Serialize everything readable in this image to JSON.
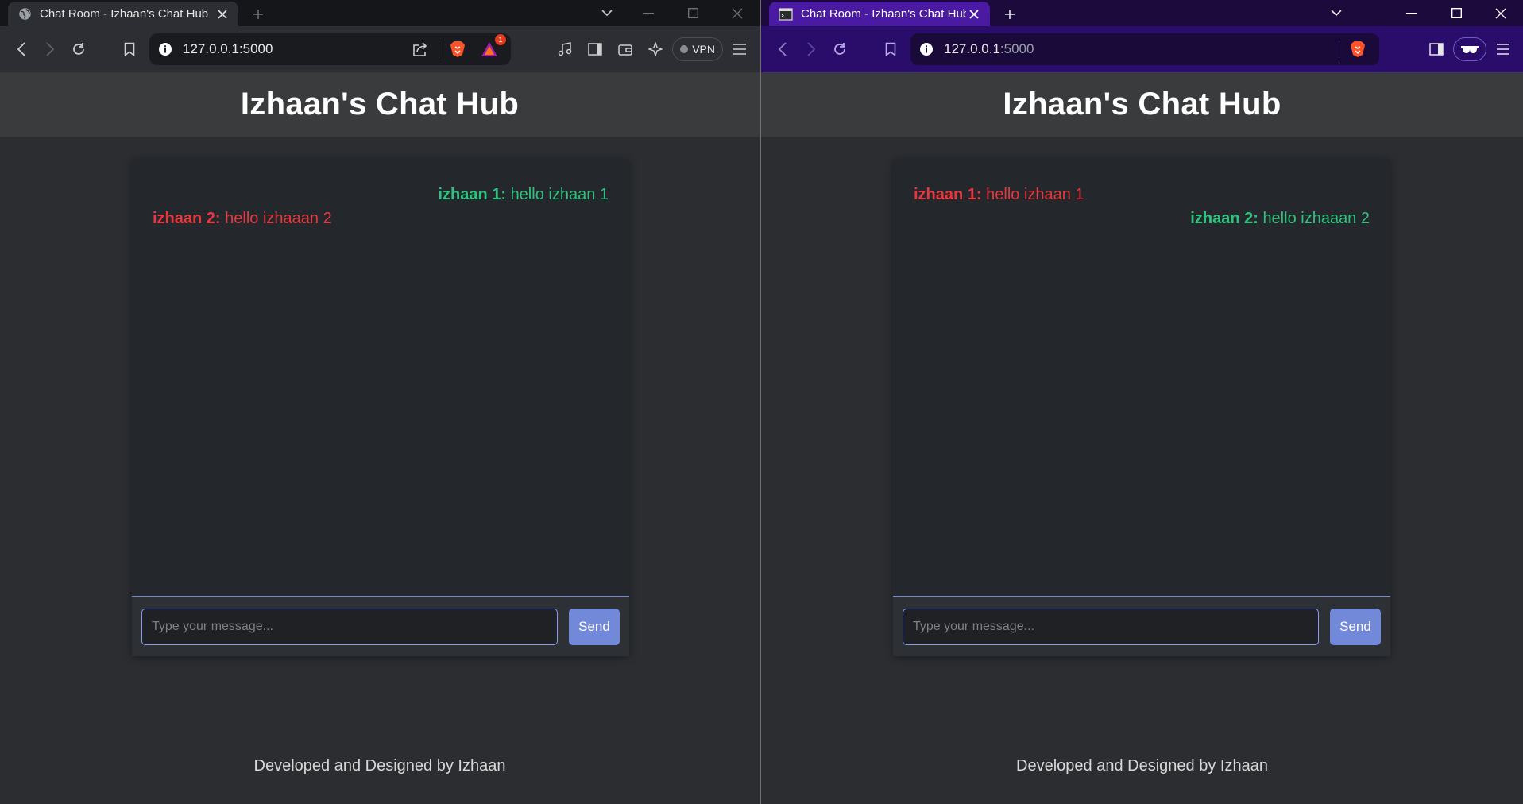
{
  "windows": [
    {
      "id": "left",
      "tab": {
        "title": "Chat Room - Izhaan's Chat Hub",
        "icon": "globe-icon"
      },
      "url": {
        "host": "127.0.0.1",
        "port": ":5000"
      },
      "rewards_badge": "1",
      "vpn_label": "VPN",
      "page": {
        "title": "Izhaan's Chat Hub",
        "messages": [
          {
            "sender": "izhaan 1:",
            "text": "hello izhaan 1",
            "align": "right",
            "color": "#2ec27e"
          },
          {
            "sender": "izhaan 2:",
            "text": "hello izhaaan 2",
            "align": "left",
            "color": "#e8373e"
          }
        ],
        "input_placeholder": "Type your message...",
        "send_label": "Send",
        "footer": "Developed and Designed by Izhaan"
      }
    },
    {
      "id": "right",
      "tab": {
        "title": "Chat Room - Izhaan's Chat Hub",
        "icon": "terminal-icon"
      },
      "url": {
        "host": "127.0.0.1",
        "port": ":5000"
      },
      "page": {
        "title": "Izhaan's Chat Hub",
        "messages": [
          {
            "sender": "izhaan 1:",
            "text": "hello izhaan 1",
            "align": "left",
            "color": "#e8373e"
          },
          {
            "sender": "izhaan 2:",
            "text": "hello izhaaan 2",
            "align": "right",
            "color": "#2ec27e"
          }
        ],
        "input_placeholder": "Type your message...",
        "send_label": "Send",
        "footer": "Developed and Designed by Izhaan"
      }
    }
  ],
  "colors": {
    "accent": "#7289da",
    "own_message": "#2ec27e",
    "other_message": "#e8373e",
    "left_browser_frame": "#151619",
    "right_browser_frame": "#2a0c6b"
  }
}
